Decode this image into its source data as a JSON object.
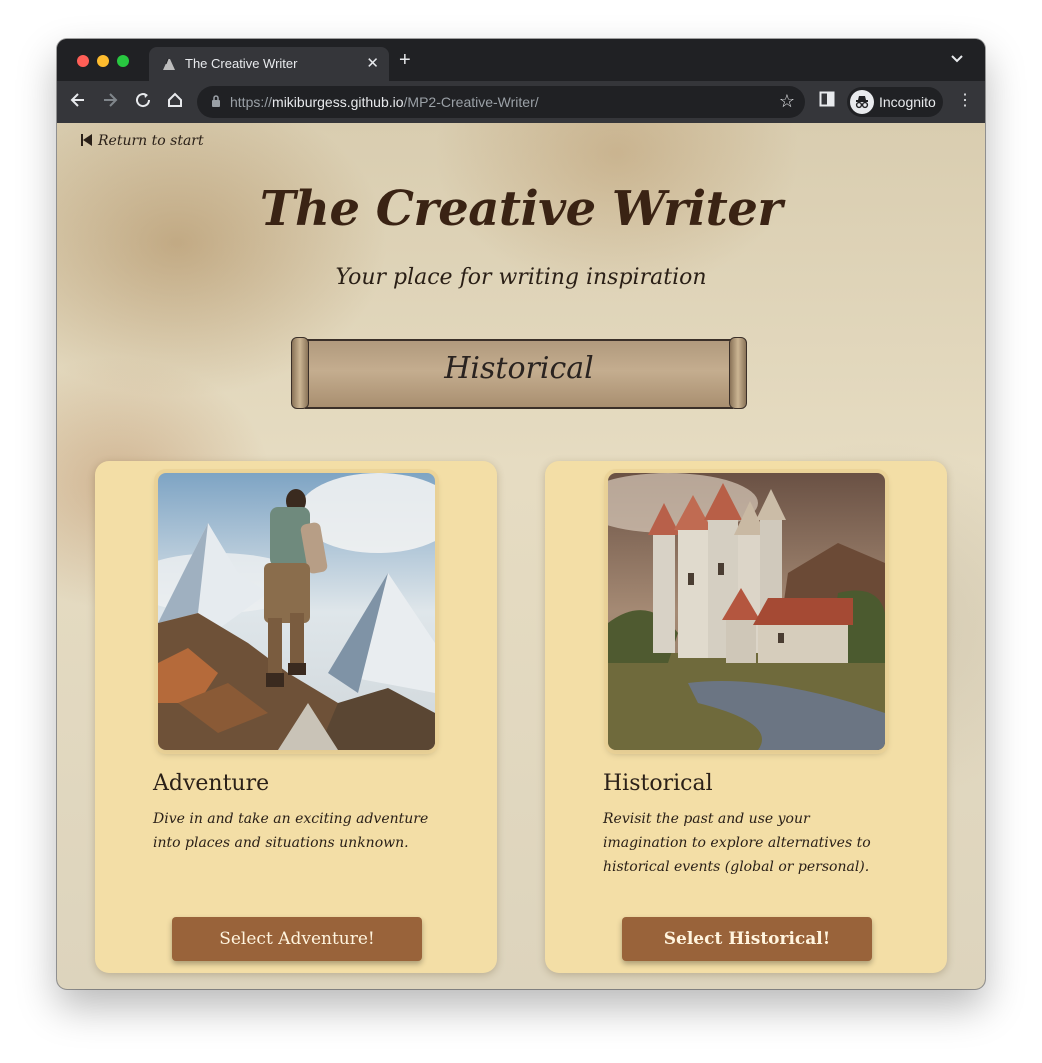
{
  "browser": {
    "tab_title": "The Creative Writer",
    "url_scheme": "https://",
    "url_host": "mikiburgess.github.io",
    "url_path": "/MP2-Creative-Writer/",
    "profile_label": "Incognito",
    "new_tab_glyph": "+",
    "close_glyph": "✕"
  },
  "page": {
    "return_link": "Return to start",
    "title": "The Creative Writer",
    "subtitle": "Your place for writing inspiration",
    "banner": "Historical"
  },
  "cards": [
    {
      "title": "Adventure",
      "description": "Dive in and take an exciting adventure into places and situations unknown.",
      "button": "Select Adventure!"
    },
    {
      "title": "Historical",
      "description": "Revisit the past and use your imagination to explore alternatives to historical events (global or personal).",
      "button": "Select Historical!"
    }
  ],
  "colors": {
    "card_bg": "#f3dea6",
    "button_bg": "#99633a",
    "title_color": "#3a2314"
  },
  "icons": [
    "back-arrow-icon",
    "forward-arrow-icon",
    "reload-icon",
    "home-icon",
    "lock-icon",
    "star-icon",
    "side-panel-icon",
    "incognito-icon",
    "more-icon",
    "skip-back-icon"
  ]
}
